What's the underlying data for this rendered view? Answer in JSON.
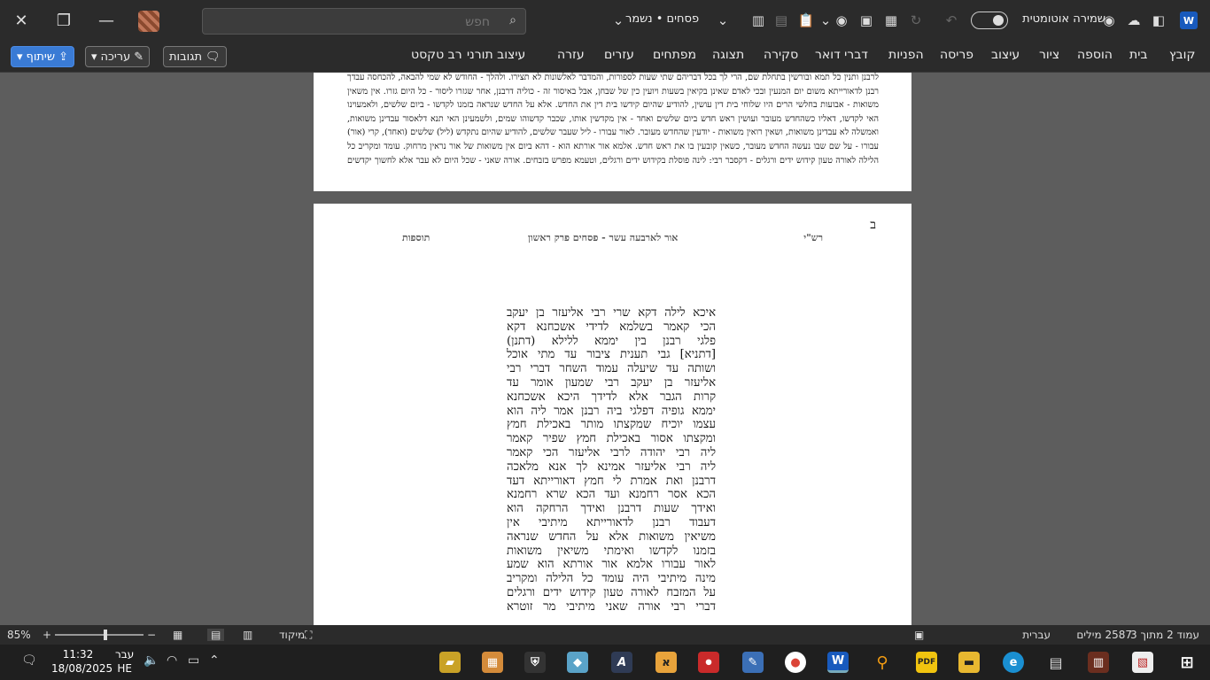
{
  "titlebar": {
    "search_placeholder": "חפש",
    "doc_name": "פסחים • נשמר",
    "autosave_label": "שמירה אוטומטית",
    "app_icon": "W"
  },
  "ribbon": {
    "tabs": [
      "קובץ",
      "בית",
      "הוספה",
      "ציור",
      "עיצוב",
      "פריסה",
      "הפניות",
      "דברי דואר",
      "סקירה",
      "תצוגה",
      "מפתחים",
      "עזרים",
      "עזרה",
      "עיצוב תורני",
      "רב טקסט"
    ],
    "share_label": "שיתוף",
    "edit_label": "עריכה",
    "comments_label": "תגובות"
  },
  "page1": {
    "text": "לרבנן ותנין כל תמא ובורשין בתחלת שם, הרי לך בכל דבריהם שתי שעות לספורות, והמדבר לאלשונות לא תצירו. ולהלך - החודש לא שמי להבאה, להכחסה עבדך רבנן לדאורייתא משום יום המנעין ובכי לאדם שאינן בקיאין בשעות ויועין כין של שבחן, אבל באיסור זה - כוליה דרבנן, אחר שגזרו ליסור - כל היום גזרו. אין משאין משואות - אבועות בחלשי הרים היו שלוחי בית דין עושין, להודיע שהיום קידשו בית דין את החדש. אלא על החדש שנראה בזמנו לקדשו - ביום שלשים, ולאמעוינו האי לקדשו, דאליו כשהחדש מעובר ועושין ראש חדש ביום שלשים ואחד - אין מקדשין אותו, שכבר קדשוהו שמים, ולשמעינן האי תנא דלאסור עבדינן משואות, ואמשלה לא עבדינן משואות, ושאין רואין משואות - יודעין שהחדש מעובר. לאור עבורו - ליל שעבר שלשים, להודיע שהיום נתקדש (ליל) שלשים (ואחד), קרי (אור) עבורו - על שם שבו נעשה החדש מעובר, כשאין קובעין בו את ראש חדש. אלמא אור אורתא הוא - דהא ביום אין משואות של אור נראין מרחוק. עומד ומקריב כל הלילה לאורה טעון קידוש ידים ורגלים - דקסבר רבי: לינה פוסלת בקידוש ידים ורגלים, וטעמא מפרש בזבחים. אורה שאני - שכל היום לא עבר אלא לחשוך יקדשים מבוקר"
  },
  "page2": {
    "page_letter": "ב",
    "header_right": "רש\"י",
    "header_center": "אור לארבעה עשר - פסחים פרק ראשון",
    "header_left": "תוספות",
    "gemara_lines": [
      "איכא לילה דקא שרי רבי אליעזר בן יעקב",
      "הכי קאמר בשלמא לדידי אשכחנא דקא",
      "פלגי רבנן בין יממא ללילא (דתנן)",
      "[דתניא] גבי תענית ציבור עד מתי אוכל",
      "ושותה עד שיעלה עמוד השחר דברי רבי",
      "אליעזר בן יעקב רבי שמעון אומר עד",
      "קרות הגבר אלא לדידך היכא אשכחנא",
      "יממא גופיה דפלגי ביה רבנן אמר ליה הוא",
      "עצמו יוכיח שמקצתו מותר באכילת חמץ",
      "ומקצתו אסור באכילת חמץ שפיר קאמר",
      "ליה רבי יהודה לרבי אליעזר הכי קאמר",
      "ליה רבי אליעזר אמינא לך אנא מלאכה",
      "דרבנן ואת אמרת לי חמץ דאורייתא דעד",
      "הכא אסר רחמנא ועד הכא שרא רחמנא",
      "ואידך שעות דרבנן ואידך הרחקה הוא",
      "דעבוד רבנן לדאורייתא מיתיבי אין",
      "משיאין משואות אלא על החדש שנראה",
      "בזמנו לקדשו ואימתי משיאין משואות",
      "לאור עבורו אלמא אור אורתא הוא שמע",
      "מינה מיתיבי היה עומד כל הלילה ומקריב",
      "על המזבח לאורה טעון קידוש ידים ורגלים",
      "דברי רבי אורה שאני מיתיבי מר זוטרא"
    ]
  },
  "statusbar": {
    "page_info": "עמוד 2 מתוך 3",
    "word_count": "2587 מילים",
    "language": "עברית",
    "focus_label": "מיקוד",
    "zoom": "85%"
  },
  "taskbar": {
    "time": "11:32",
    "date": "18/08/2025",
    "lang_top": "עבר",
    "lang_bottom": "HE"
  },
  "colors": {
    "accent": "#3a7bd5",
    "word_blue": "#185abd",
    "chrome": "#2b2b2b",
    "canvas": "#5d5d5d"
  }
}
